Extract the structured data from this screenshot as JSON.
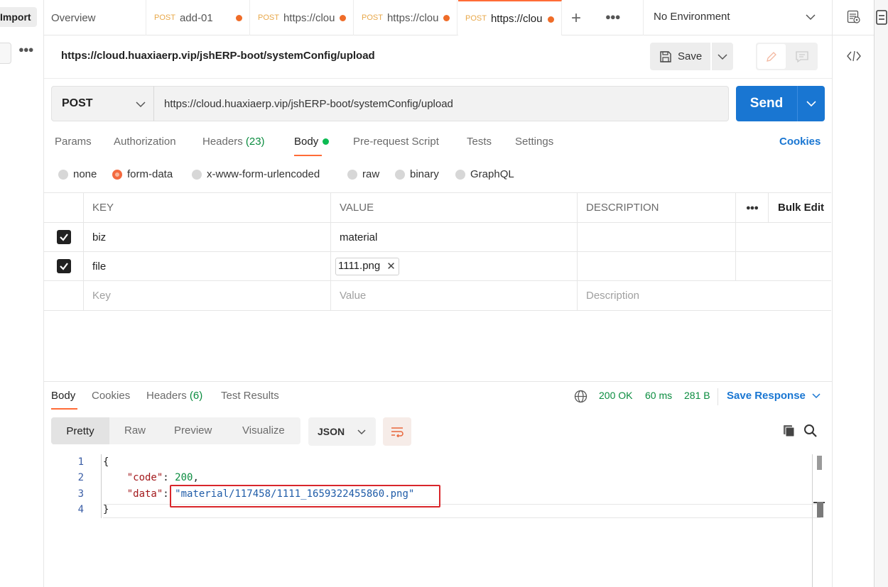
{
  "sidebar": {
    "import_label": "Import"
  },
  "tabs": {
    "overview": "Overview",
    "items": [
      {
        "method": "POST",
        "title": "add-01"
      },
      {
        "method": "POST",
        "title": "https://cloud"
      },
      {
        "method": "POST",
        "title": "https://cloud"
      },
      {
        "method": "POST",
        "title": "https://cloud"
      }
    ],
    "environment": "No Environment"
  },
  "request": {
    "title": "https://cloud.huaxiaerp.vip/jshERP-boot/systemConfig/upload",
    "save_label": "Save",
    "method": "POST",
    "url": "https://cloud.huaxiaerp.vip/jshERP-boot/systemConfig/upload",
    "send_label": "Send",
    "tabs": {
      "params": "Params",
      "authorization": "Authorization",
      "headers": "Headers",
      "headers_count": "(23)",
      "body": "Body",
      "pre_request": "Pre-request Script",
      "tests": "Tests",
      "settings": "Settings"
    },
    "cookies_label": "Cookies",
    "body_types": [
      "none",
      "form-data",
      "x-www-form-urlencoded",
      "raw",
      "binary",
      "GraphQL"
    ],
    "body_type_selected": "form-data"
  },
  "form_table": {
    "headers": {
      "key": "KEY",
      "value": "VALUE",
      "description": "DESCRIPTION",
      "bulk_edit": "Bulk Edit"
    },
    "rows": [
      {
        "key": "biz",
        "value": "material",
        "checked": true
      },
      {
        "key": "file",
        "value": "1111.png",
        "checked": true
      }
    ],
    "placeholders": {
      "key": "Key",
      "value": "Value",
      "description": "Description"
    }
  },
  "response": {
    "tabs": {
      "body": "Body",
      "cookies": "Cookies",
      "headers": "Headers",
      "headers_count": "(6)",
      "test_results": "Test Results"
    },
    "status": "200 OK",
    "time": "60 ms",
    "size": "281 B",
    "save_response": "Save Response",
    "view_modes": [
      "Pretty",
      "Raw",
      "Preview",
      "Visualize"
    ],
    "format": "JSON",
    "code": {
      "line_numbers": [
        "1",
        "2",
        "3",
        "4"
      ],
      "open_brace": "{",
      "close_brace": "}",
      "code_key": "\"code\"",
      "code_value": "200",
      "data_key": "\"data\"",
      "data_value": "\"material/117458/1111_1659322455860.png\""
    }
  }
}
